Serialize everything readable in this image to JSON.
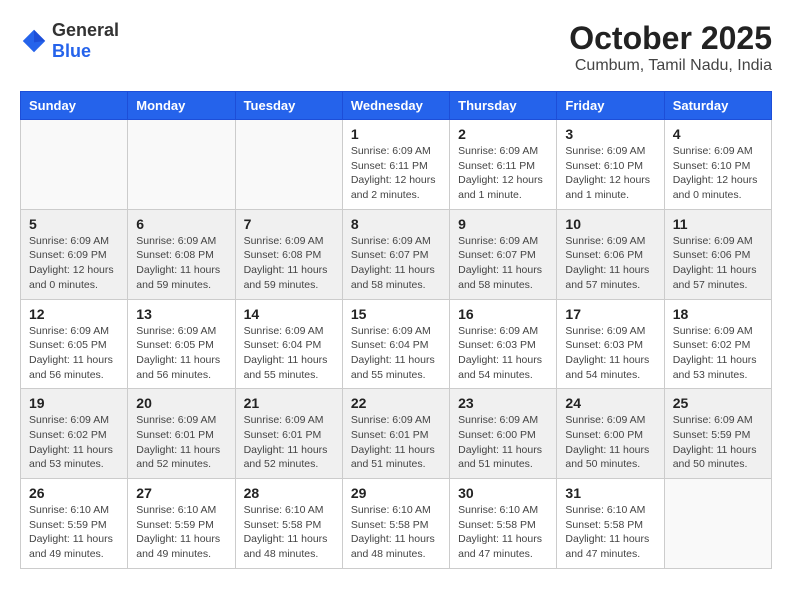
{
  "header": {
    "logo": {
      "text_general": "General",
      "text_blue": "Blue"
    },
    "month": "October 2025",
    "location": "Cumbum, Tamil Nadu, India"
  },
  "weekdays": [
    "Sunday",
    "Monday",
    "Tuesday",
    "Wednesday",
    "Thursday",
    "Friday",
    "Saturday"
  ],
  "weeks": [
    [
      {
        "day": "",
        "sunrise": "",
        "sunset": "",
        "daylight": ""
      },
      {
        "day": "",
        "sunrise": "",
        "sunset": "",
        "daylight": ""
      },
      {
        "day": "",
        "sunrise": "",
        "sunset": "",
        "daylight": ""
      },
      {
        "day": "1",
        "sunrise": "Sunrise: 6:09 AM",
        "sunset": "Sunset: 6:11 PM",
        "daylight": "Daylight: 12 hours and 2 minutes."
      },
      {
        "day": "2",
        "sunrise": "Sunrise: 6:09 AM",
        "sunset": "Sunset: 6:11 PM",
        "daylight": "Daylight: 12 hours and 1 minute."
      },
      {
        "day": "3",
        "sunrise": "Sunrise: 6:09 AM",
        "sunset": "Sunset: 6:10 PM",
        "daylight": "Daylight: 12 hours and 1 minute."
      },
      {
        "day": "4",
        "sunrise": "Sunrise: 6:09 AM",
        "sunset": "Sunset: 6:10 PM",
        "daylight": "Daylight: 12 hours and 0 minutes."
      }
    ],
    [
      {
        "day": "5",
        "sunrise": "Sunrise: 6:09 AM",
        "sunset": "Sunset: 6:09 PM",
        "daylight": "Daylight: 12 hours and 0 minutes."
      },
      {
        "day": "6",
        "sunrise": "Sunrise: 6:09 AM",
        "sunset": "Sunset: 6:08 PM",
        "daylight": "Daylight: 11 hours and 59 minutes."
      },
      {
        "day": "7",
        "sunrise": "Sunrise: 6:09 AM",
        "sunset": "Sunset: 6:08 PM",
        "daylight": "Daylight: 11 hours and 59 minutes."
      },
      {
        "day": "8",
        "sunrise": "Sunrise: 6:09 AM",
        "sunset": "Sunset: 6:07 PM",
        "daylight": "Daylight: 11 hours and 58 minutes."
      },
      {
        "day": "9",
        "sunrise": "Sunrise: 6:09 AM",
        "sunset": "Sunset: 6:07 PM",
        "daylight": "Daylight: 11 hours and 58 minutes."
      },
      {
        "day": "10",
        "sunrise": "Sunrise: 6:09 AM",
        "sunset": "Sunset: 6:06 PM",
        "daylight": "Daylight: 11 hours and 57 minutes."
      },
      {
        "day": "11",
        "sunrise": "Sunrise: 6:09 AM",
        "sunset": "Sunset: 6:06 PM",
        "daylight": "Daylight: 11 hours and 57 minutes."
      }
    ],
    [
      {
        "day": "12",
        "sunrise": "Sunrise: 6:09 AM",
        "sunset": "Sunset: 6:05 PM",
        "daylight": "Daylight: 11 hours and 56 minutes."
      },
      {
        "day": "13",
        "sunrise": "Sunrise: 6:09 AM",
        "sunset": "Sunset: 6:05 PM",
        "daylight": "Daylight: 11 hours and 56 minutes."
      },
      {
        "day": "14",
        "sunrise": "Sunrise: 6:09 AM",
        "sunset": "Sunset: 6:04 PM",
        "daylight": "Daylight: 11 hours and 55 minutes."
      },
      {
        "day": "15",
        "sunrise": "Sunrise: 6:09 AM",
        "sunset": "Sunset: 6:04 PM",
        "daylight": "Daylight: 11 hours and 55 minutes."
      },
      {
        "day": "16",
        "sunrise": "Sunrise: 6:09 AM",
        "sunset": "Sunset: 6:03 PM",
        "daylight": "Daylight: 11 hours and 54 minutes."
      },
      {
        "day": "17",
        "sunrise": "Sunrise: 6:09 AM",
        "sunset": "Sunset: 6:03 PM",
        "daylight": "Daylight: 11 hours and 54 minutes."
      },
      {
        "day": "18",
        "sunrise": "Sunrise: 6:09 AM",
        "sunset": "Sunset: 6:02 PM",
        "daylight": "Daylight: 11 hours and 53 minutes."
      }
    ],
    [
      {
        "day": "19",
        "sunrise": "Sunrise: 6:09 AM",
        "sunset": "Sunset: 6:02 PM",
        "daylight": "Daylight: 11 hours and 53 minutes."
      },
      {
        "day": "20",
        "sunrise": "Sunrise: 6:09 AM",
        "sunset": "Sunset: 6:01 PM",
        "daylight": "Daylight: 11 hours and 52 minutes."
      },
      {
        "day": "21",
        "sunrise": "Sunrise: 6:09 AM",
        "sunset": "Sunset: 6:01 PM",
        "daylight": "Daylight: 11 hours and 52 minutes."
      },
      {
        "day": "22",
        "sunrise": "Sunrise: 6:09 AM",
        "sunset": "Sunset: 6:01 PM",
        "daylight": "Daylight: 11 hours and 51 minutes."
      },
      {
        "day": "23",
        "sunrise": "Sunrise: 6:09 AM",
        "sunset": "Sunset: 6:00 PM",
        "daylight": "Daylight: 11 hours and 51 minutes."
      },
      {
        "day": "24",
        "sunrise": "Sunrise: 6:09 AM",
        "sunset": "Sunset: 6:00 PM",
        "daylight": "Daylight: 11 hours and 50 minutes."
      },
      {
        "day": "25",
        "sunrise": "Sunrise: 6:09 AM",
        "sunset": "Sunset: 5:59 PM",
        "daylight": "Daylight: 11 hours and 50 minutes."
      }
    ],
    [
      {
        "day": "26",
        "sunrise": "Sunrise: 6:10 AM",
        "sunset": "Sunset: 5:59 PM",
        "daylight": "Daylight: 11 hours and 49 minutes."
      },
      {
        "day": "27",
        "sunrise": "Sunrise: 6:10 AM",
        "sunset": "Sunset: 5:59 PM",
        "daylight": "Daylight: 11 hours and 49 minutes."
      },
      {
        "day": "28",
        "sunrise": "Sunrise: 6:10 AM",
        "sunset": "Sunset: 5:58 PM",
        "daylight": "Daylight: 11 hours and 48 minutes."
      },
      {
        "day": "29",
        "sunrise": "Sunrise: 6:10 AM",
        "sunset": "Sunset: 5:58 PM",
        "daylight": "Daylight: 11 hours and 48 minutes."
      },
      {
        "day": "30",
        "sunrise": "Sunrise: 6:10 AM",
        "sunset": "Sunset: 5:58 PM",
        "daylight": "Daylight: 11 hours and 47 minutes."
      },
      {
        "day": "31",
        "sunrise": "Sunrise: 6:10 AM",
        "sunset": "Sunset: 5:58 PM",
        "daylight": "Daylight: 11 hours and 47 minutes."
      },
      {
        "day": "",
        "sunrise": "",
        "sunset": "",
        "daylight": ""
      }
    ]
  ]
}
